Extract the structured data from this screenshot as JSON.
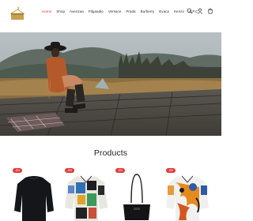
{
  "header": {
    "logo_icon": "hanger-box-logo-icon",
    "nav": [
      {
        "label": "Home",
        "active": true
      },
      {
        "label": "Shop",
        "active": false
      },
      {
        "label": "Avenzaa",
        "active": false
      },
      {
        "label": "Pilgaadio",
        "active": false
      },
      {
        "label": "Versace",
        "active": false
      },
      {
        "label": "Prada",
        "active": false
      },
      {
        "label": "Burberry",
        "active": false
      },
      {
        "label": "Evaca",
        "active": false
      },
      {
        "label": "Kenzo",
        "active": false
      },
      {
        "label": "A.P.C.",
        "active": false
      }
    ],
    "icons": [
      "search-icon",
      "user-icon",
      "cart-icon"
    ],
    "accent_color": "#e0413a"
  },
  "hero": {
    "image": "model-in-fringe-jacket-on-wooden-dock"
  },
  "products": {
    "title": "Products",
    "items": [
      {
        "badge": "-8%",
        "image": "black-sweater"
      },
      {
        "badge": "-8%",
        "image": "printed-shirt"
      },
      {
        "badge": "-8%",
        "image": "black-shoulder-bag"
      },
      {
        "badge": "-8%",
        "image": "orange-printed-shirt"
      }
    ],
    "badge_color": "#e23b3b"
  }
}
